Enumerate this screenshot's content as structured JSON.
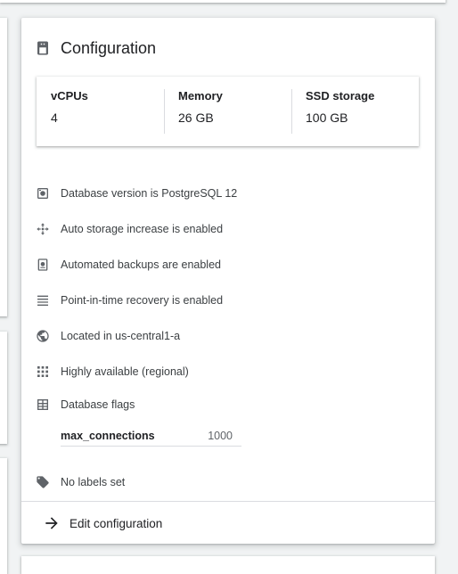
{
  "card": {
    "title": "Configuration",
    "specs": [
      {
        "label": "vCPUs",
        "value": "4"
      },
      {
        "label": "Memory",
        "value": "26 GB"
      },
      {
        "label": "SSD storage",
        "value": "100 GB"
      }
    ],
    "features": [
      {
        "icon": "database-version-icon",
        "text": "Database version is PostgreSQL 12"
      },
      {
        "icon": "auto-storage-icon",
        "text": "Auto storage increase is enabled"
      },
      {
        "icon": "backup-icon",
        "text": "Automated backups are enabled"
      },
      {
        "icon": "recovery-icon",
        "text": "Point-in-time recovery is enabled"
      },
      {
        "icon": "globe-icon",
        "text": "Located in us-central1-a"
      },
      {
        "icon": "grid-icon",
        "text": "Highly available (regional)"
      },
      {
        "icon": "table-icon",
        "text": "Database flags"
      }
    ],
    "flags": [
      {
        "name": "max_connections",
        "value": "1000"
      }
    ],
    "labels_text": "No labels set",
    "edit_label": "Edit configuration"
  }
}
